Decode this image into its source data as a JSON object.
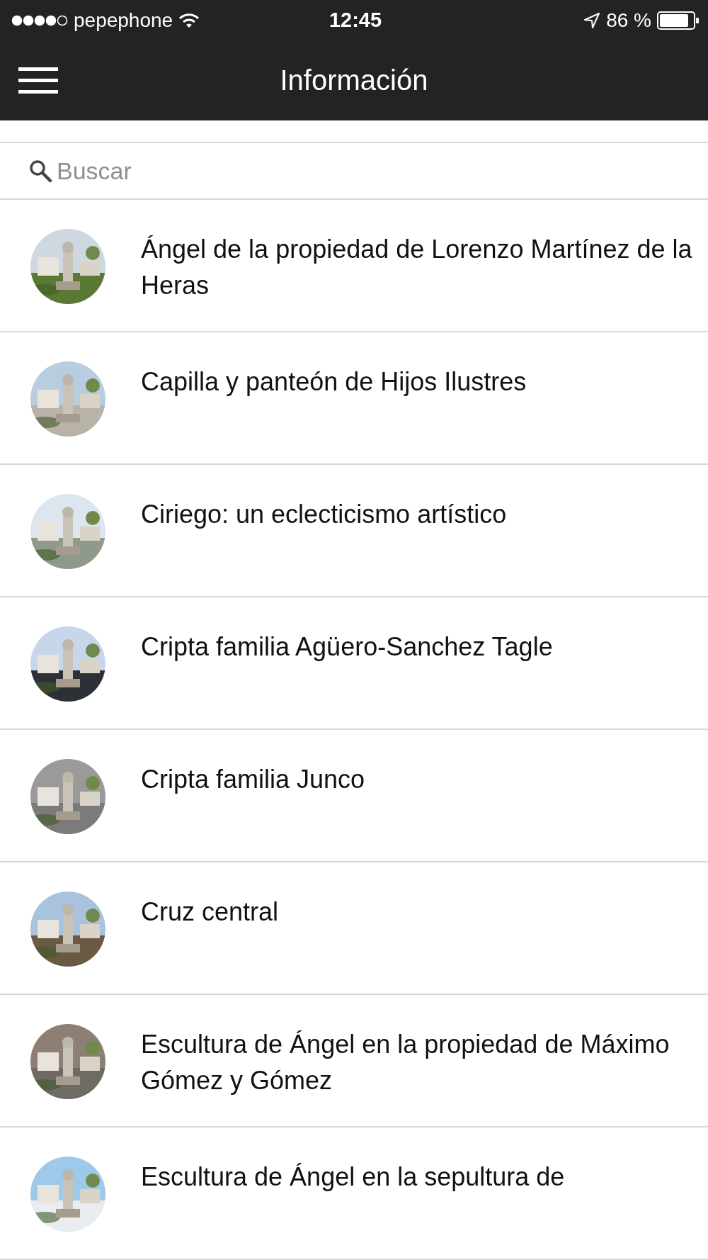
{
  "status_bar": {
    "carrier": "pepephone",
    "time": "12:45",
    "battery": "86 %"
  },
  "nav_bar": {
    "title": "Información"
  },
  "search": {
    "placeholder": "Buscar"
  },
  "items": [
    {
      "title": "Ángel de la propiedad de Lorenzo Martínez de la Heras"
    },
    {
      "title": "Capilla y panteón de Hijos Ilustres"
    },
    {
      "title": "Ciriego: un eclecticismo artístico"
    },
    {
      "title": "Cripta familia Agüero-Sanchez Tagle"
    },
    {
      "title": "Cripta familia Junco"
    },
    {
      "title": "Cruz central"
    },
    {
      "title": "Escultura de Ángel en la propiedad de Máximo Gómez y Gómez"
    },
    {
      "title": "Escultura de Ángel en la sepultura de"
    }
  ]
}
